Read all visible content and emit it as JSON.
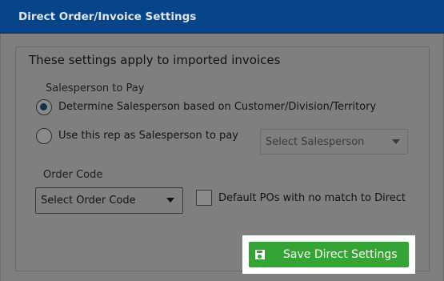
{
  "header": {
    "title": "Direct Order/Invoice Settings"
  },
  "intro": "These settings apply to imported invoices",
  "salesperson": {
    "section_label": "Salesperson to Pay",
    "options": [
      {
        "label": "Determine Salesperson based on Customer/Division/Territory",
        "checked": true
      },
      {
        "label": "Use this rep as Salesperson to pay",
        "checked": false
      }
    ],
    "select_placeholder": "Select Salesperson"
  },
  "order_code": {
    "label": "Order Code",
    "select_placeholder": "Select Order Code"
  },
  "default_pos": {
    "label": "Default POs with no match to Direct",
    "checked": false
  },
  "save_button": {
    "label": "Save Direct Settings",
    "icon": "floppy-disk-icon",
    "color": "#34a534"
  }
}
